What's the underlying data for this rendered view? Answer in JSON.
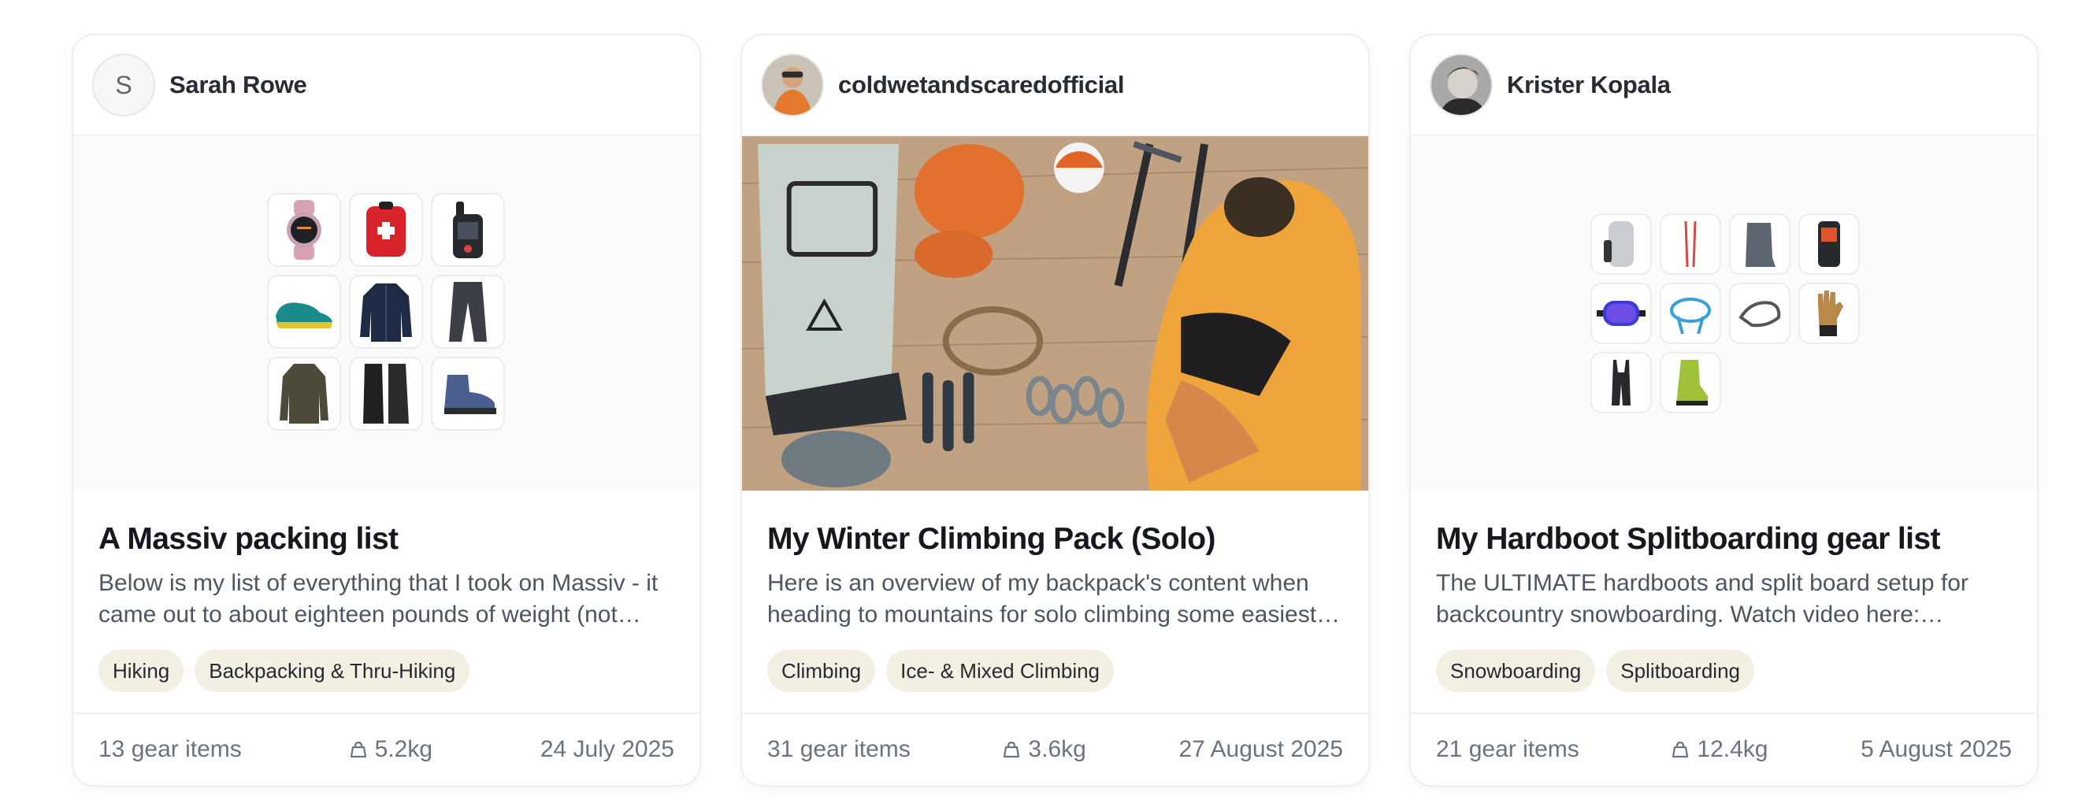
{
  "cards": [
    {
      "author": "Sarah Rowe",
      "avatar_initial": "S",
      "title": "A Massiv packing list",
      "description": "Below is my list of everything that I took on Massiv - it came out to about eighteen pounds of weight (not…",
      "tags": [
        "Hiking",
        "Backpacking & Thru-Hiking"
      ],
      "gear_count": "13 gear items",
      "weight": "5.2kg",
      "date": "24 July 2025",
      "thumbs": [
        "watch-icon",
        "first-aid-kit-icon",
        "gps-device-icon",
        "trail-shoe-icon",
        "puffer-jacket-icon",
        "pants-icon",
        "rain-jacket-icon",
        "gaiters-icon",
        "hiking-boot-icon"
      ]
    },
    {
      "author": "coldwetandscaredofficial",
      "title": "My Winter Climbing Pack (Solo)",
      "description": "Here is an overview of my backpack's content when heading to mountains for solo climbing some easiest…",
      "tags": [
        "Climbing",
        "Ice- & Mixed Climbing"
      ],
      "gear_count": "31 gear items",
      "weight": "3.6kg",
      "date": "27 August 2025"
    },
    {
      "author": "Krister Kopala",
      "title": "My Hardboot Splitboarding gear list",
      "description": "The ULTIMATE hardboots and split board setup for backcountry snowboarding. Watch video here:…",
      "tags": [
        "Snowboarding",
        "Splitboarding"
      ],
      "gear_count": "21 gear items",
      "weight": "12.4kg",
      "date": "5 August 2025",
      "thumbs": [
        "backpack-icon",
        "poles-icon",
        "boot-liner-icon",
        "avalanche-beacon-icon",
        "goggles-icon",
        "harness-icon",
        "crampon-icon",
        "glove-icon",
        "bib-pants-icon",
        "hardboot-icon"
      ]
    }
  ]
}
